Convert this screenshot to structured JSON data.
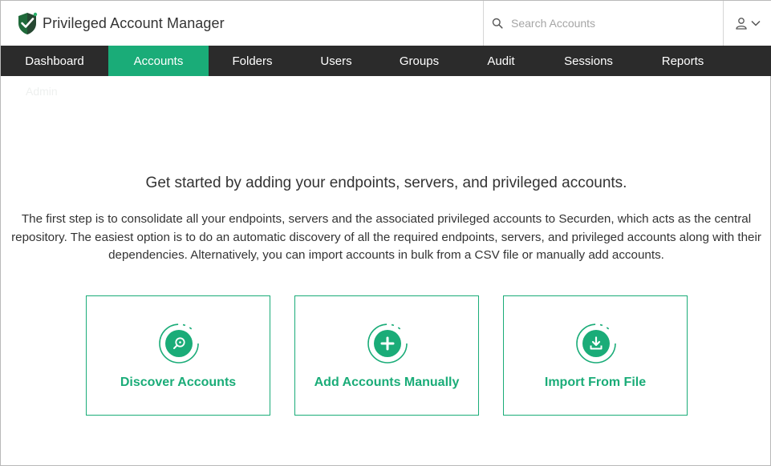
{
  "app": {
    "title": "Privileged Account Manager"
  },
  "search": {
    "placeholder": "Search Accounts",
    "value": ""
  },
  "nav": {
    "items": [
      {
        "label": "Dashboard",
        "active": false
      },
      {
        "label": "Accounts",
        "active": true
      },
      {
        "label": "Folders",
        "active": false
      },
      {
        "label": "Users",
        "active": false
      },
      {
        "label": "Groups",
        "active": false
      },
      {
        "label": "Audit",
        "active": false
      },
      {
        "label": "Sessions",
        "active": false
      },
      {
        "label": "Reports",
        "active": false
      }
    ],
    "overflow_label": "Admin"
  },
  "main": {
    "heading": "Get started by adding your endpoints, servers, and privileged accounts.",
    "description": "The first step is to consolidate all your endpoints, servers and the associated privileged accounts to Securden, which acts as the central repository. The easiest option is to do an automatic discovery of all the required endpoints, servers, and privileged accounts along with their dependencies. Alternatively, you can import accounts in bulk from a CSV file or manually add accounts."
  },
  "cards": [
    {
      "label": "Discover Accounts",
      "icon": "search-icon"
    },
    {
      "label": "Add Accounts Manually",
      "icon": "plus-icon"
    },
    {
      "label": "Import From File",
      "icon": "download-icon"
    }
  ],
  "icons": {
    "brand": "shield-check-icon",
    "search": "magnifier-icon",
    "user": "user-icon",
    "dropdown": "chevron-down-icon"
  },
  "colors": {
    "accent": "#1aac78",
    "nav_background": "#2b2b2b",
    "nav_text": "#ffffff",
    "text": "#333333"
  }
}
